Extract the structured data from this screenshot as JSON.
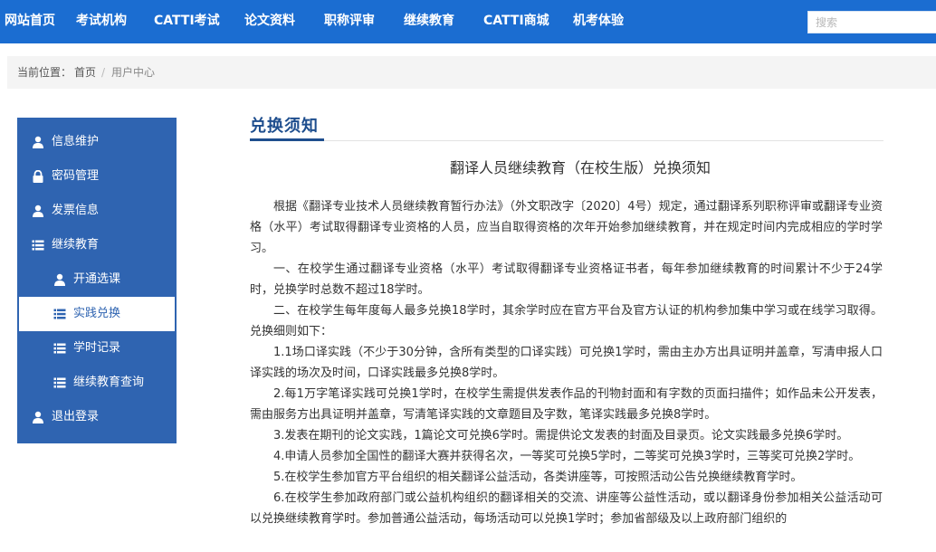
{
  "nav": {
    "items": [
      "网站首页",
      "考试机构",
      "CATTI考试",
      "论文资料",
      "职称评审",
      "继续教育",
      "CATTI商城",
      "机考体验"
    ],
    "search_placeholder": "搜索"
  },
  "breadcrumb": {
    "prefix": "当前位置：",
    "home": "首页",
    "separator": "/",
    "current": "用户中心"
  },
  "sidebar": {
    "items": [
      {
        "label": "信息维护",
        "icon": "user-icon"
      },
      {
        "label": "密码管理",
        "icon": "lock-icon"
      },
      {
        "label": "发票信息",
        "icon": "user-icon"
      },
      {
        "label": "继续教育",
        "icon": "list-icon"
      },
      {
        "label": "开通选课",
        "icon": "user-icon"
      },
      {
        "label": "实践兑换",
        "icon": "list-icon",
        "active": true
      },
      {
        "label": "学时记录",
        "icon": "list-icon"
      },
      {
        "label": "继续教育查询",
        "icon": "list-icon"
      },
      {
        "label": "退出登录",
        "icon": "user-icon"
      }
    ]
  },
  "content": {
    "section_title": "兑换须知",
    "doc_title": "翻译人员继续教育（在校生版）兑换须知",
    "paragraphs": [
      "根据《翻译专业技术人员继续教育暂行办法》（外文职改字〔2020〕4号）规定，通过翻译系列职称评审或翻译专业资格（水平）考试取得翻译专业资格的人员，应当自取得资格的次年开始参加继续教育，并在规定时间内完成相应的学时学习。",
      "一、在校学生通过翻译专业资格（水平）考试取得翻译专业资格证书者，每年参加继续教育的时间累计不少于24学时，兑换学时总数不超过18学时。",
      "二、在校学生每年度每人最多兑换18学时，其余学时应在官方平台及官方认证的机构参加集中学习或在线学习取得。兑换细则如下：",
      "1.1场口译实践（不少于30分钟，含所有类型的口译实践）可兑换1学时，需由主办方出具证明并盖章，写清申报人口译实践的场次及时间，口译实践最多兑换8学时。",
      "2.每1万字笔译实践可兑换1学时，在校学生需提供发表作品的刊物封面和有字数的页面扫描件；如作品未公开发表，需由服务方出具证明并盖章，写清笔译实践的文章题目及字数，笔译实践最多兑换8学时。",
      "3.发表在期刊的论文实践，1篇论文可兑换6学时。需提供论文发表的封面及目录页。论文实践最多兑换6学时。",
      "4.申请人员参加全国性的翻译大赛并获得名次，一等奖可兑换5学时，二等奖可兑换3学时，三等奖可兑换2学时。",
      "5.在校学生参加官方平台组织的相关翻译公益活动，各类讲座等，可按照活动公告兑换继续教育学时。",
      "6.在校学生参加政府部门或公益机构组织的翻译相关的交流、讲座等公益性活动，或以翻译身份参加相关公益活动可以兑换继续教育学时。参加普通公益活动，每场活动可以兑换1学时；参加省部级及以上政府部门组织的"
    ]
  },
  "colors": {
    "nav_bg": "#1b6dd1",
    "sidebar_bg": "#2f64b1",
    "title_color": "#1e4e8e"
  }
}
